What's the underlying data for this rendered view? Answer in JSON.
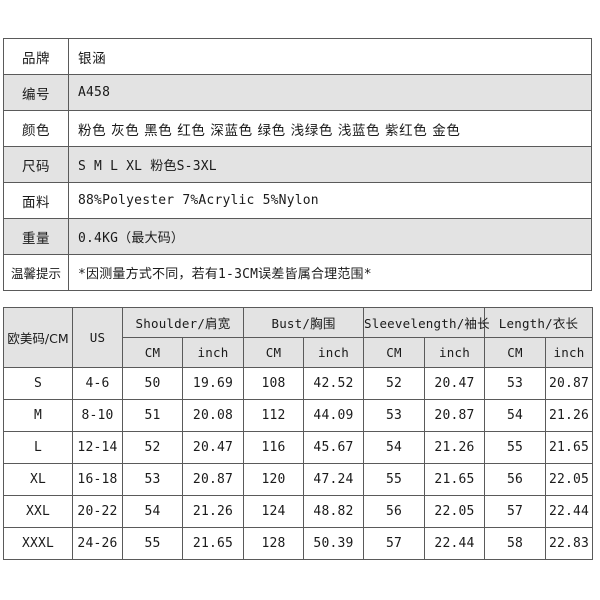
{
  "spec_table": {
    "rows": [
      {
        "label": "品牌",
        "value": "银涵"
      },
      {
        "label": "编号",
        "value": "A458"
      },
      {
        "label": "颜色",
        "value": "粉色 灰色 黑色 红色 深蓝色 绿色 浅绿色 浅蓝色 紫红色 金色"
      },
      {
        "label": "尺码",
        "value": "S M L XL  粉色S-3XL"
      },
      {
        "label": "面料",
        "value": "88%Polyester  7%Acrylic  5%Nylon"
      },
      {
        "label": "重量",
        "value": "0.4KG（最大码）"
      },
      {
        "label": "温馨提示",
        "value": "*因测量方式不同，若有1-3CM误差皆属合理范围*"
      }
    ]
  },
  "size_table": {
    "corner_header": "欧美码/CM",
    "us_header": "US",
    "groups": [
      {
        "label": "Shoulder/肩宽"
      },
      {
        "label": "Bust/胸围"
      },
      {
        "label": "Sleevelength/袖长"
      },
      {
        "label": "Length/衣长"
      }
    ],
    "unit_cm": "CM",
    "unit_inch": "inch",
    "rows": [
      {
        "size": "S",
        "us": "4-6",
        "shoulder_cm": "50",
        "shoulder_in": "19.69",
        "bust_cm": "108",
        "bust_in": "42.52",
        "sleeve_cm": "52",
        "sleeve_in": "20.47",
        "length_cm": "53",
        "length_in": "20.87"
      },
      {
        "size": "M",
        "us": "8-10",
        "shoulder_cm": "51",
        "shoulder_in": "20.08",
        "bust_cm": "112",
        "bust_in": "44.09",
        "sleeve_cm": "53",
        "sleeve_in": "20.87",
        "length_cm": "54",
        "length_in": "21.26"
      },
      {
        "size": "L",
        "us": "12-14",
        "shoulder_cm": "52",
        "shoulder_in": "20.47",
        "bust_cm": "116",
        "bust_in": "45.67",
        "sleeve_cm": "54",
        "sleeve_in": "21.26",
        "length_cm": "55",
        "length_in": "21.65"
      },
      {
        "size": "XL",
        "us": "16-18",
        "shoulder_cm": "53",
        "shoulder_in": "20.87",
        "bust_cm": "120",
        "bust_in": "47.24",
        "sleeve_cm": "55",
        "sleeve_in": "21.65",
        "length_cm": "56",
        "length_in": "22.05"
      },
      {
        "size": "XXL",
        "us": "20-22",
        "shoulder_cm": "54",
        "shoulder_in": "21.26",
        "bust_cm": "124",
        "bust_in": "48.82",
        "sleeve_cm": "56",
        "sleeve_in": "22.05",
        "length_cm": "57",
        "length_in": "22.44"
      },
      {
        "size": "XXXL",
        "us": "24-26",
        "shoulder_cm": "55",
        "shoulder_in": "21.65",
        "bust_cm": "128",
        "bust_in": "50.39",
        "sleeve_cm": "57",
        "sleeve_in": "22.44",
        "length_cm": "58",
        "length_in": "22.83"
      }
    ]
  },
  "colors": {
    "border": "#5a5a5a",
    "shaded_row": "#e3e3e3",
    "plain_row": "#ffffff",
    "text": "#1a1a1a"
  }
}
